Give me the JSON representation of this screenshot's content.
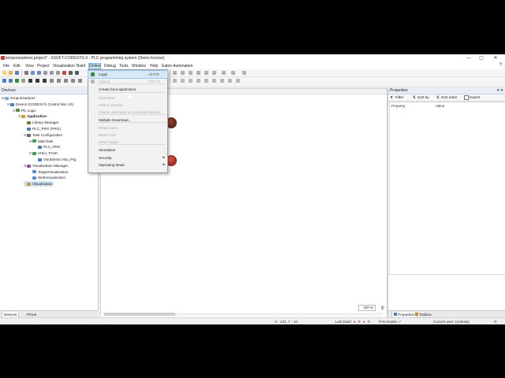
{
  "window": {
    "title": "temporizadores.project* - XSOFT-CODESYS-3 - PLC programming system (Demo license)",
    "minimize": "—",
    "maximize": "▢",
    "close": "✕"
  },
  "menubar": {
    "items": [
      "File",
      "Edit",
      "View",
      "Project",
      "Visualization",
      "Build",
      "Online",
      "Debug",
      "Tools",
      "Window",
      "Help",
      "Eaton Automation"
    ],
    "active": "Online",
    "help_icon": "?"
  },
  "devices_panel": {
    "title": "Devices",
    "pin": "▾ ✕",
    "tree": [
      {
        "label": "temporizadores",
        "indent": 0,
        "exp": "⊟",
        "icon": "#7aa7d8"
      },
      {
        "label": "Device (CODESYS Control Win V3)",
        "indent": 1,
        "exp": "⊟",
        "icon": "#4e79b8"
      },
      {
        "label": "Plc Logic",
        "indent": 2,
        "exp": "⊟",
        "icon": "#5a8c3a"
      },
      {
        "label": "Application",
        "indent": 3,
        "exp": "⊟",
        "icon": "#d09a2e",
        "bold": true
      },
      {
        "label": "Library Manager",
        "indent": 4,
        "exp": "",
        "icon": "#8a6d3b"
      },
      {
        "label": "PLC_PRG (PRG)",
        "indent": 4,
        "exp": "",
        "icon": "#4a7fc1"
      },
      {
        "label": "Task Configuration",
        "indent": 4,
        "exp": "⊟",
        "icon": "#6a6a6a"
      },
      {
        "label": "MainTask",
        "indent": 5,
        "exp": "⊟",
        "icon": "#3f9a4e"
      },
      {
        "label": "PLC_PRG",
        "indent": 6,
        "exp": "",
        "icon": "#4a7fc1"
      },
      {
        "label": "VISU_TASK",
        "indent": 5,
        "exp": "⊟",
        "icon": "#3f9a4e"
      },
      {
        "label": "VisuElems.Visu_Prg",
        "indent": 6,
        "exp": "",
        "icon": "#4a7fc1"
      },
      {
        "label": "Visualization Manager",
        "indent": 4,
        "exp": "⊟",
        "icon": "#9a4ea8"
      },
      {
        "label": "TargetVisualization",
        "indent": 5,
        "exp": "",
        "icon": "#5c8bd1"
      },
      {
        "label": "WebVisualization",
        "indent": 5,
        "exp": "",
        "icon": "#5c8bd1"
      },
      {
        "label": "Visualization",
        "indent": 4,
        "exp": "",
        "icon": "#d09a2e",
        "selected": true
      }
    ],
    "tabs": [
      "Devices",
      "POUs"
    ]
  },
  "online_menu": {
    "items": [
      {
        "label": "Login",
        "shortcut": "Alt+F8",
        "state": "highlight",
        "icon": "#3c8c3c"
      },
      {
        "label": "Logout",
        "shortcut": "Ctrl+F8",
        "state": "disabled",
        "icon": "#b8b8b8"
      },
      {
        "label": "Create boot application",
        "shortcut": "",
        "state": "normal"
      },
      {
        "label": "Download",
        "shortcut": "",
        "state": "disabled"
      },
      {
        "label": "Online Change",
        "shortcut": "",
        "state": "disabled"
      },
      {
        "label": "Source download to connected device",
        "shortcut": "",
        "state": "disabled"
      },
      {
        "label": "Multiple Download...",
        "shortcut": "",
        "state": "normal"
      },
      {
        "label": "Reset warm",
        "shortcut": "",
        "state": "disabled"
      },
      {
        "label": "Reset cold",
        "shortcut": "",
        "state": "disabled"
      },
      {
        "label": "Reset origin",
        "shortcut": "",
        "state": "disabled"
      },
      {
        "label": "Simulation",
        "shortcut": "",
        "state": "normal"
      },
      {
        "label": "Security",
        "shortcut": "",
        "state": "normal",
        "submenu": true
      },
      {
        "label": "Operating Mode",
        "shortcut": "",
        "state": "normal",
        "submenu": true
      }
    ],
    "submenu_arrow": "▸"
  },
  "editor": {
    "zoom": "100 %",
    "lamp_colors": [
      "#7a2a1a",
      "#c0281e"
    ]
  },
  "properties_panel": {
    "title": "Properties",
    "pin": "▾ ✕",
    "filter": "Filter",
    "sort_by": "Sort by",
    "sort_order": "Sort order",
    "expert": "Expert",
    "col_property": "Property",
    "col_value": "Value",
    "tabs": [
      "Properties",
      "Toolbox"
    ]
  },
  "statusbar": {
    "coords": "X : 442, Y : 18",
    "last_build_label": "Last build:",
    "last_build_errors": "0",
    "last_build_warnings": "0",
    "precompile_label": "Precompile:",
    "precompile_ok": "✔",
    "user": "Current user: (nobody)"
  },
  "colors": {
    "accent": "#cde6f7",
    "menu_border": "#9a9a9a",
    "error_red": "#d22b2b",
    "ok_green": "#2e9a3c"
  }
}
